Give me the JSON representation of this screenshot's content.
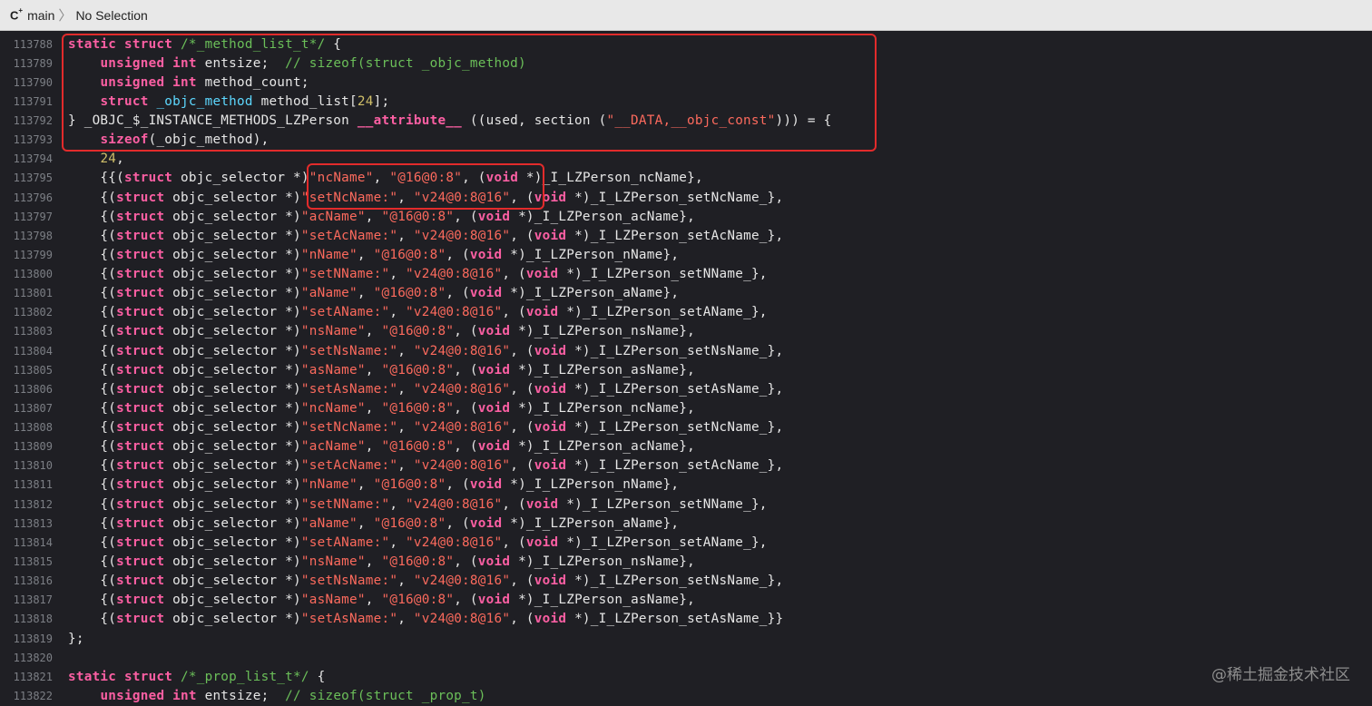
{
  "header": {
    "file_label": "main",
    "breadcrumb_sep": "〉",
    "selection_label": "No Selection",
    "file_icon": "c-plus-file-icon"
  },
  "code_lines": [
    {
      "ln": "113788",
      "parts": [
        [
          "kw",
          "static"
        ],
        [
          "",
          ""
        ],
        [
          "",
          ""
        ]
      ]
    }
  ],
  "line_numbers": [
    "113788",
    "113789",
    "113790",
    "113791",
    "113792",
    "113793",
    "113794",
    "113795",
    "113796",
    "113797",
    "113798",
    "113799",
    "113800",
    "113801",
    "113802",
    "113803",
    "113804",
    "113805",
    "113806",
    "113807",
    "113808",
    "113809",
    "113810",
    "113811",
    "113812",
    "113813",
    "113814",
    "113815",
    "113816",
    "113817",
    "113818",
    "113819",
    "113820",
    "113821",
    "113822"
  ],
  "lines": [
    [
      [
        "kw",
        "static struct "
      ],
      [
        "cm",
        "/*_method_list_t*/"
      ],
      [
        "",
        " {"
      ]
    ],
    [
      [
        "",
        "    "
      ],
      [
        "kw",
        "unsigned int"
      ],
      [
        "",
        " entsize;  "
      ],
      [
        "cm",
        "// sizeof(struct _objc_method)"
      ]
    ],
    [
      [
        "",
        "    "
      ],
      [
        "kw",
        "unsigned int"
      ],
      [
        "",
        " method_count;"
      ]
    ],
    [
      [
        "",
        "    "
      ],
      [
        "kw",
        "struct"
      ],
      [
        "",
        " "
      ],
      [
        "ty",
        "_objc_method"
      ],
      [
        "",
        " method_list["
      ],
      [
        "nm",
        "24"
      ],
      [
        "",
        "];"
      ]
    ],
    [
      [
        "",
        "} _OBJC_$_INSTANCE_METHODS_LZPerson "
      ],
      [
        "kw",
        "__attribute__"
      ],
      [
        "",
        " ((used, section ("
      ],
      [
        "st",
        "\"__DATA,__objc_const\""
      ],
      [
        "",
        ")))"
      ],
      [
        "",
        " = {"
      ]
    ],
    [
      [
        "",
        "    "
      ],
      [
        "kw",
        "sizeof"
      ],
      [
        "",
        "(_objc_method),"
      ]
    ],
    [
      [
        "",
        "    "
      ],
      [
        "nm",
        "24"
      ],
      [
        "",
        ","
      ]
    ],
    [
      [
        "",
        "    {{("
      ],
      [
        "kw",
        "struct"
      ],
      [
        "",
        " objc_selector *)"
      ],
      [
        "st",
        "\"ncName\""
      ],
      [
        "",
        ", "
      ],
      [
        "st",
        "\"@16@0:8\""
      ],
      [
        "",
        ", ("
      ],
      [
        "kw",
        "void"
      ],
      [
        "",
        " *)_I_LZPerson_ncName},"
      ]
    ],
    [
      [
        "",
        "    {("
      ],
      [
        "kw",
        "struct"
      ],
      [
        "",
        " objc_selector *)"
      ],
      [
        "st",
        "\"setNcName:\""
      ],
      [
        "",
        ", "
      ],
      [
        "st",
        "\"v24@0:8@16\""
      ],
      [
        "",
        ", ("
      ],
      [
        "kw",
        "void"
      ],
      [
        "",
        " *)_I_LZPerson_setNcName_},"
      ]
    ],
    [
      [
        "",
        "    {("
      ],
      [
        "kw",
        "struct"
      ],
      [
        "",
        " objc_selector *)"
      ],
      [
        "st",
        "\"acName\""
      ],
      [
        "",
        ", "
      ],
      [
        "st",
        "\"@16@0:8\""
      ],
      [
        "",
        ", ("
      ],
      [
        "kw",
        "void"
      ],
      [
        "",
        " *)_I_LZPerson_acName},"
      ]
    ],
    [
      [
        "",
        "    {("
      ],
      [
        "kw",
        "struct"
      ],
      [
        "",
        " objc_selector *)"
      ],
      [
        "st",
        "\"setAcName:\""
      ],
      [
        "",
        ", "
      ],
      [
        "st",
        "\"v24@0:8@16\""
      ],
      [
        "",
        ", ("
      ],
      [
        "kw",
        "void"
      ],
      [
        "",
        " *)_I_LZPerson_setAcName_},"
      ]
    ],
    [
      [
        "",
        "    {("
      ],
      [
        "kw",
        "struct"
      ],
      [
        "",
        " objc_selector *)"
      ],
      [
        "st",
        "\"nName\""
      ],
      [
        "",
        ", "
      ],
      [
        "st",
        "\"@16@0:8\""
      ],
      [
        "",
        ", ("
      ],
      [
        "kw",
        "void"
      ],
      [
        "",
        " *)_I_LZPerson_nName},"
      ]
    ],
    [
      [
        "",
        "    {("
      ],
      [
        "kw",
        "struct"
      ],
      [
        "",
        " objc_selector *)"
      ],
      [
        "st",
        "\"setNName:\""
      ],
      [
        "",
        ", "
      ],
      [
        "st",
        "\"v24@0:8@16\""
      ],
      [
        "",
        ", ("
      ],
      [
        "kw",
        "void"
      ],
      [
        "",
        " *)_I_LZPerson_setNName_},"
      ]
    ],
    [
      [
        "",
        "    {("
      ],
      [
        "kw",
        "struct"
      ],
      [
        "",
        " objc_selector *)"
      ],
      [
        "st",
        "\"aName\""
      ],
      [
        "",
        ", "
      ],
      [
        "st",
        "\"@16@0:8\""
      ],
      [
        "",
        ", ("
      ],
      [
        "kw",
        "void"
      ],
      [
        "",
        " *)_I_LZPerson_aName},"
      ]
    ],
    [
      [
        "",
        "    {("
      ],
      [
        "kw",
        "struct"
      ],
      [
        "",
        " objc_selector *)"
      ],
      [
        "st",
        "\"setAName:\""
      ],
      [
        "",
        ", "
      ],
      [
        "st",
        "\"v24@0:8@16\""
      ],
      [
        "",
        ", ("
      ],
      [
        "kw",
        "void"
      ],
      [
        "",
        " *)_I_LZPerson_setAName_},"
      ]
    ],
    [
      [
        "",
        "    {("
      ],
      [
        "kw",
        "struct"
      ],
      [
        "",
        " objc_selector *)"
      ],
      [
        "st",
        "\"nsName\""
      ],
      [
        "",
        ", "
      ],
      [
        "st",
        "\"@16@0:8\""
      ],
      [
        "",
        ", ("
      ],
      [
        "kw",
        "void"
      ],
      [
        "",
        " *)_I_LZPerson_nsName},"
      ]
    ],
    [
      [
        "",
        "    {("
      ],
      [
        "kw",
        "struct"
      ],
      [
        "",
        " objc_selector *)"
      ],
      [
        "st",
        "\"setNsName:\""
      ],
      [
        "",
        ", "
      ],
      [
        "st",
        "\"v24@0:8@16\""
      ],
      [
        "",
        ", ("
      ],
      [
        "kw",
        "void"
      ],
      [
        "",
        " *)_I_LZPerson_setNsName_},"
      ]
    ],
    [
      [
        "",
        "    {("
      ],
      [
        "kw",
        "struct"
      ],
      [
        "",
        " objc_selector *)"
      ],
      [
        "st",
        "\"asName\""
      ],
      [
        "",
        ", "
      ],
      [
        "st",
        "\"@16@0:8\""
      ],
      [
        "",
        ", ("
      ],
      [
        "kw",
        "void"
      ],
      [
        "",
        " *)_I_LZPerson_asName},"
      ]
    ],
    [
      [
        "",
        "    {("
      ],
      [
        "kw",
        "struct"
      ],
      [
        "",
        " objc_selector *)"
      ],
      [
        "st",
        "\"setAsName:\""
      ],
      [
        "",
        ", "
      ],
      [
        "st",
        "\"v24@0:8@16\""
      ],
      [
        "",
        ", ("
      ],
      [
        "kw",
        "void"
      ],
      [
        "",
        " *)_I_LZPerson_setAsName_},"
      ]
    ],
    [
      [
        "",
        "    {("
      ],
      [
        "kw",
        "struct"
      ],
      [
        "",
        " objc_selector *)"
      ],
      [
        "st",
        "\"ncName\""
      ],
      [
        "",
        ", "
      ],
      [
        "st",
        "\"@16@0:8\""
      ],
      [
        "",
        ", ("
      ],
      [
        "kw",
        "void"
      ],
      [
        "",
        " *)_I_LZPerson_ncName},"
      ]
    ],
    [
      [
        "",
        "    {("
      ],
      [
        "kw",
        "struct"
      ],
      [
        "",
        " objc_selector *)"
      ],
      [
        "st",
        "\"setNcName:\""
      ],
      [
        "",
        ", "
      ],
      [
        "st",
        "\"v24@0:8@16\""
      ],
      [
        "",
        ", ("
      ],
      [
        "kw",
        "void"
      ],
      [
        "",
        " *)_I_LZPerson_setNcName_},"
      ]
    ],
    [
      [
        "",
        "    {("
      ],
      [
        "kw",
        "struct"
      ],
      [
        "",
        " objc_selector *)"
      ],
      [
        "st",
        "\"acName\""
      ],
      [
        "",
        ", "
      ],
      [
        "st",
        "\"@16@0:8\""
      ],
      [
        "",
        ", ("
      ],
      [
        "kw",
        "void"
      ],
      [
        "",
        " *)_I_LZPerson_acName},"
      ]
    ],
    [
      [
        "",
        "    {("
      ],
      [
        "kw",
        "struct"
      ],
      [
        "",
        " objc_selector *)"
      ],
      [
        "st",
        "\"setAcName:\""
      ],
      [
        "",
        ", "
      ],
      [
        "st",
        "\"v24@0:8@16\""
      ],
      [
        "",
        ", ("
      ],
      [
        "kw",
        "void"
      ],
      [
        "",
        " *)_I_LZPerson_setAcName_},"
      ]
    ],
    [
      [
        "",
        "    {("
      ],
      [
        "kw",
        "struct"
      ],
      [
        "",
        " objc_selector *)"
      ],
      [
        "st",
        "\"nName\""
      ],
      [
        "",
        ", "
      ],
      [
        "st",
        "\"@16@0:8\""
      ],
      [
        "",
        ", ("
      ],
      [
        "kw",
        "void"
      ],
      [
        "",
        " *)_I_LZPerson_nName},"
      ]
    ],
    [
      [
        "",
        "    {("
      ],
      [
        "kw",
        "struct"
      ],
      [
        "",
        " objc_selector *)"
      ],
      [
        "st",
        "\"setNName:\""
      ],
      [
        "",
        ", "
      ],
      [
        "st",
        "\"v24@0:8@16\""
      ],
      [
        "",
        ", ("
      ],
      [
        "kw",
        "void"
      ],
      [
        "",
        " *)_I_LZPerson_setNName_},"
      ]
    ],
    [
      [
        "",
        "    {("
      ],
      [
        "kw",
        "struct"
      ],
      [
        "",
        " objc_selector *)"
      ],
      [
        "st",
        "\"aName\""
      ],
      [
        "",
        ", "
      ],
      [
        "st",
        "\"@16@0:8\""
      ],
      [
        "",
        ", ("
      ],
      [
        "kw",
        "void"
      ],
      [
        "",
        " *)_I_LZPerson_aName},"
      ]
    ],
    [
      [
        "",
        "    {("
      ],
      [
        "kw",
        "struct"
      ],
      [
        "",
        " objc_selector *)"
      ],
      [
        "st",
        "\"setAName:\""
      ],
      [
        "",
        ", "
      ],
      [
        "st",
        "\"v24@0:8@16\""
      ],
      [
        "",
        ", ("
      ],
      [
        "kw",
        "void"
      ],
      [
        "",
        " *)_I_LZPerson_setAName_},"
      ]
    ],
    [
      [
        "",
        "    {("
      ],
      [
        "kw",
        "struct"
      ],
      [
        "",
        " objc_selector *)"
      ],
      [
        "st",
        "\"nsName\""
      ],
      [
        "",
        ", "
      ],
      [
        "st",
        "\"@16@0:8\""
      ],
      [
        "",
        ", ("
      ],
      [
        "kw",
        "void"
      ],
      [
        "",
        " *)_I_LZPerson_nsName},"
      ]
    ],
    [
      [
        "",
        "    {("
      ],
      [
        "kw",
        "struct"
      ],
      [
        "",
        " objc_selector *)"
      ],
      [
        "st",
        "\"setNsName:\""
      ],
      [
        "",
        ", "
      ],
      [
        "st",
        "\"v24@0:8@16\""
      ],
      [
        "",
        ", ("
      ],
      [
        "kw",
        "void"
      ],
      [
        "",
        " *)_I_LZPerson_setNsName_},"
      ]
    ],
    [
      [
        "",
        "    {("
      ],
      [
        "kw",
        "struct"
      ],
      [
        "",
        " objc_selector *)"
      ],
      [
        "st",
        "\"asName\""
      ],
      [
        "",
        ", "
      ],
      [
        "st",
        "\"@16@0:8\""
      ],
      [
        "",
        ", ("
      ],
      [
        "kw",
        "void"
      ],
      [
        "",
        " *)_I_LZPerson_asName},"
      ]
    ],
    [
      [
        "",
        "    {("
      ],
      [
        "kw",
        "struct"
      ],
      [
        "",
        " objc_selector *)"
      ],
      [
        "st",
        "\"setAsName:\""
      ],
      [
        "",
        ", "
      ],
      [
        "st",
        "\"v24@0:8@16\""
      ],
      [
        "",
        ", ("
      ],
      [
        "kw",
        "void"
      ],
      [
        "",
        " *)_I_LZPerson_setAsName_}}"
      ]
    ],
    [
      [
        "",
        "};"
      ]
    ],
    [
      [
        "",
        ""
      ]
    ],
    [
      [
        "kw",
        "static struct "
      ],
      [
        "cm",
        "/*_prop_list_t*/"
      ],
      [
        "",
        " {"
      ]
    ],
    [
      [
        "",
        "    "
      ],
      [
        "kw",
        "unsigned int"
      ],
      [
        "",
        " entsize;  "
      ],
      [
        "cm",
        "// sizeof(struct _prop_t)"
      ]
    ]
  ],
  "colors": {
    "background": "#1f1f24",
    "keyword": "#fc5fa3",
    "comment": "#6bbf59",
    "string": "#fc6a5d",
    "type": "#5dd8ff",
    "number": "#d0bf69",
    "highlight_box": "#e22b2b"
  },
  "watermark": "@稀土掘金技术社区"
}
